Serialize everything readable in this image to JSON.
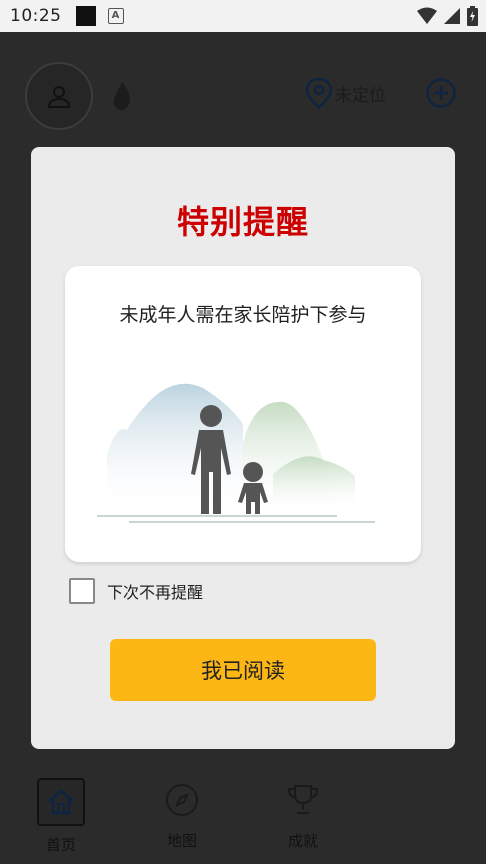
{
  "status_bar": {
    "time": "10:25",
    "notif_a": "A"
  },
  "background": {
    "location_label": "未定位",
    "tabs": [
      {
        "label": "首页",
        "icon": "home-icon"
      },
      {
        "label": "地图",
        "icon": "compass-icon"
      },
      {
        "label": "成就",
        "icon": "trophy-icon"
      }
    ]
  },
  "dialog": {
    "title": "特别提醒",
    "message": "未成年人需在家长陪护下参与",
    "dont_remind_label": "下次不再提醒",
    "dont_remind_checked": false,
    "confirm_label": "我已阅读"
  },
  "colors": {
    "title": "#cc0000",
    "button": "#fdb714",
    "dialog_bg": "#ebebeb"
  }
}
